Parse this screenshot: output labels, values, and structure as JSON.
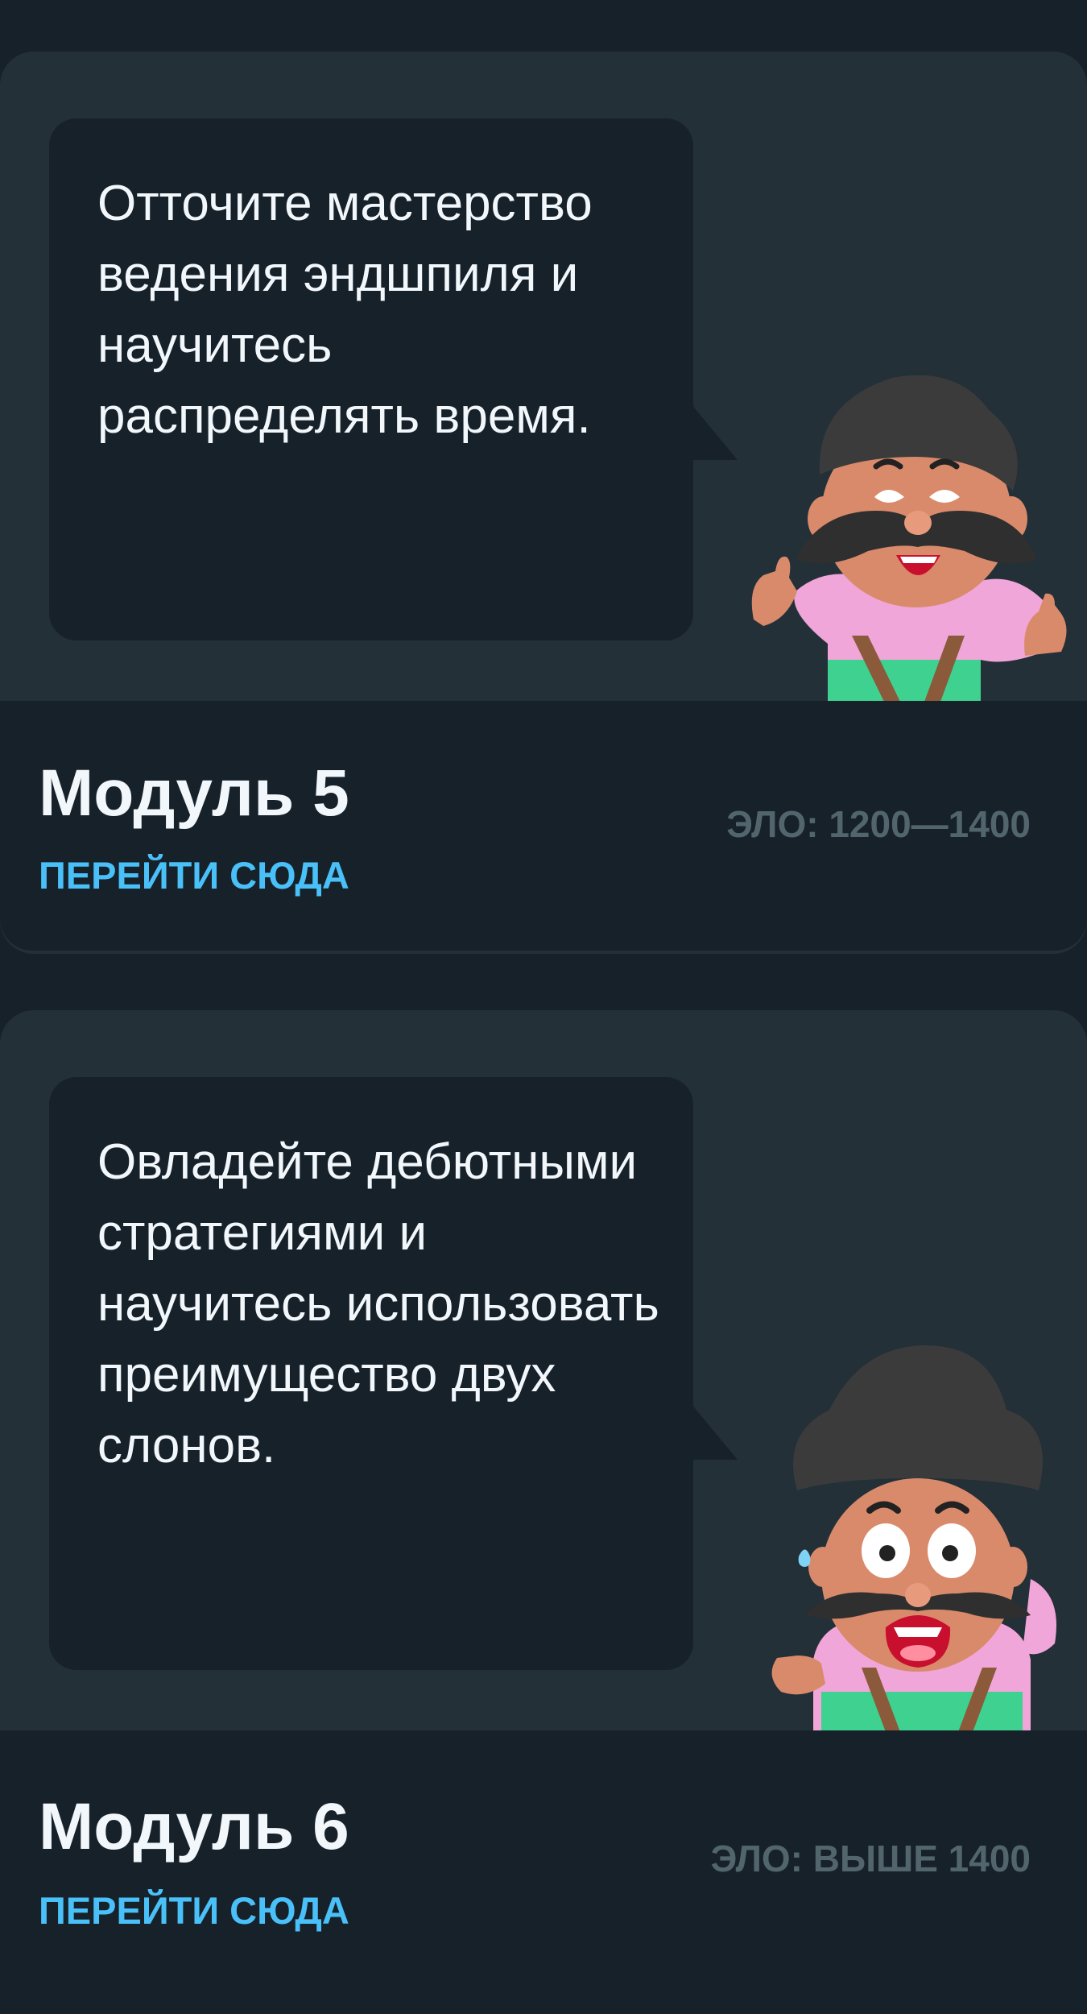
{
  "modules": [
    {
      "bubble_text": "Отточите мастерство ведения эндшпиля и научитесь распределять время.",
      "title": "Модуль 5",
      "link": "ПЕРЕЙТИ СЮДА",
      "elo": "ЭЛО: 1200—1400",
      "mascot": "mustache-man-thumbs-up"
    },
    {
      "bubble_text": "Овладейте дебютными стратегиями и научитесь использовать преимущество двух слонов.",
      "title": "Модуль 6",
      "link": "ПЕРЕЙТИ СЮДА",
      "elo": "ЭЛО: ВЫШЕ 1400",
      "mascot": "mustache-man-surprised"
    }
  ],
  "colors": {
    "background": "#17212a",
    "card": "#233038",
    "link": "#49c0f8",
    "elo": "#52656d",
    "text": "#f1f7fb"
  }
}
